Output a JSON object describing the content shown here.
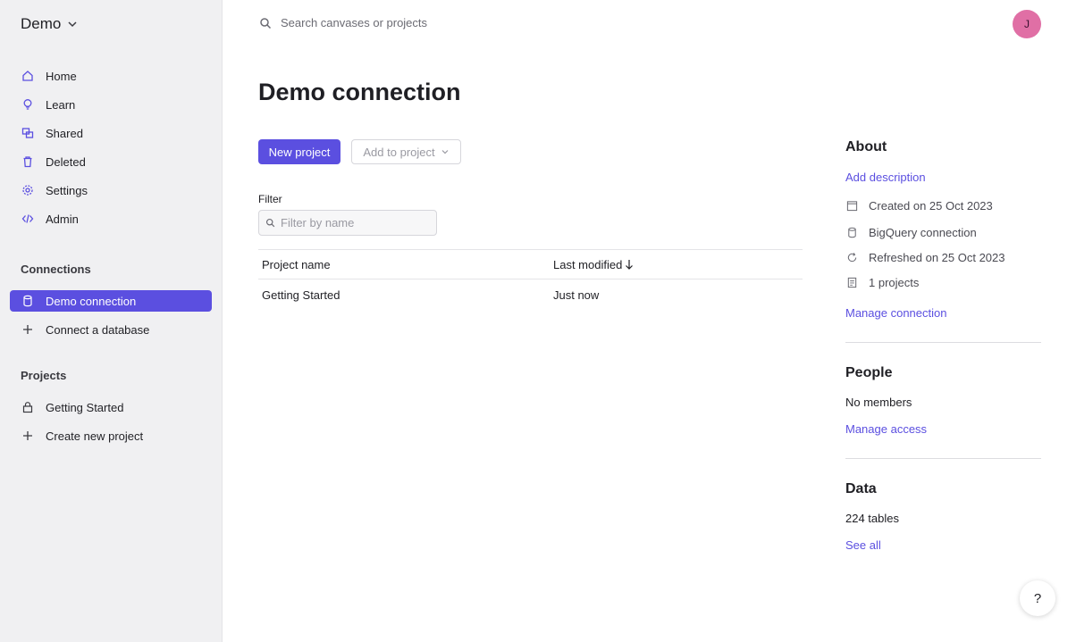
{
  "workspace": {
    "name": "Demo"
  },
  "nav": [
    {
      "label": "Home",
      "icon": "home-icon"
    },
    {
      "label": "Learn",
      "icon": "lightbulb-icon"
    },
    {
      "label": "Shared",
      "icon": "shared-icon"
    },
    {
      "label": "Deleted",
      "icon": "trash-icon"
    },
    {
      "label": "Settings",
      "icon": "gear-icon"
    },
    {
      "label": "Admin",
      "icon": "code-icon"
    }
  ],
  "connections": {
    "title": "Connections",
    "items": [
      {
        "label": "Demo connection",
        "icon": "database-icon",
        "active": true
      },
      {
        "label": "Connect a database",
        "icon": "plus-icon"
      }
    ]
  },
  "projects": {
    "title": "Projects",
    "items": [
      {
        "label": "Getting Started",
        "icon": "lock-icon"
      },
      {
        "label": "Create new project",
        "icon": "plus-icon"
      }
    ]
  },
  "search": {
    "placeholder": "Search canvases or projects"
  },
  "user": {
    "initial": "J",
    "avatar_color": "#e06fa5"
  },
  "main": {
    "title": "Demo connection",
    "new_project_label": "New project",
    "add_to_project_label": "Add to project",
    "filter": {
      "label": "Filter",
      "placeholder": "Filter by name"
    },
    "table": {
      "columns": [
        "Project name",
        "Last modified"
      ],
      "sort": "descending",
      "rows": [
        {
          "name": "Getting Started",
          "modified": "Just now"
        }
      ]
    }
  },
  "about": {
    "title": "About",
    "add_description": "Add description",
    "created": "Created on 25 Oct 2023",
    "type": "BigQuery connection",
    "refreshed": "Refreshed on 25 Oct 2023",
    "projects_count": "1 projects",
    "manage_connection": "Manage connection"
  },
  "people": {
    "title": "People",
    "members": "No members",
    "manage_access": "Manage access"
  },
  "data": {
    "title": "Data",
    "tables": "224 tables",
    "see_all": "See all"
  },
  "help": {
    "label": "?"
  },
  "colors": {
    "accent": "#5b4fe0",
    "sidebar_bg": "#f0f0f2"
  }
}
